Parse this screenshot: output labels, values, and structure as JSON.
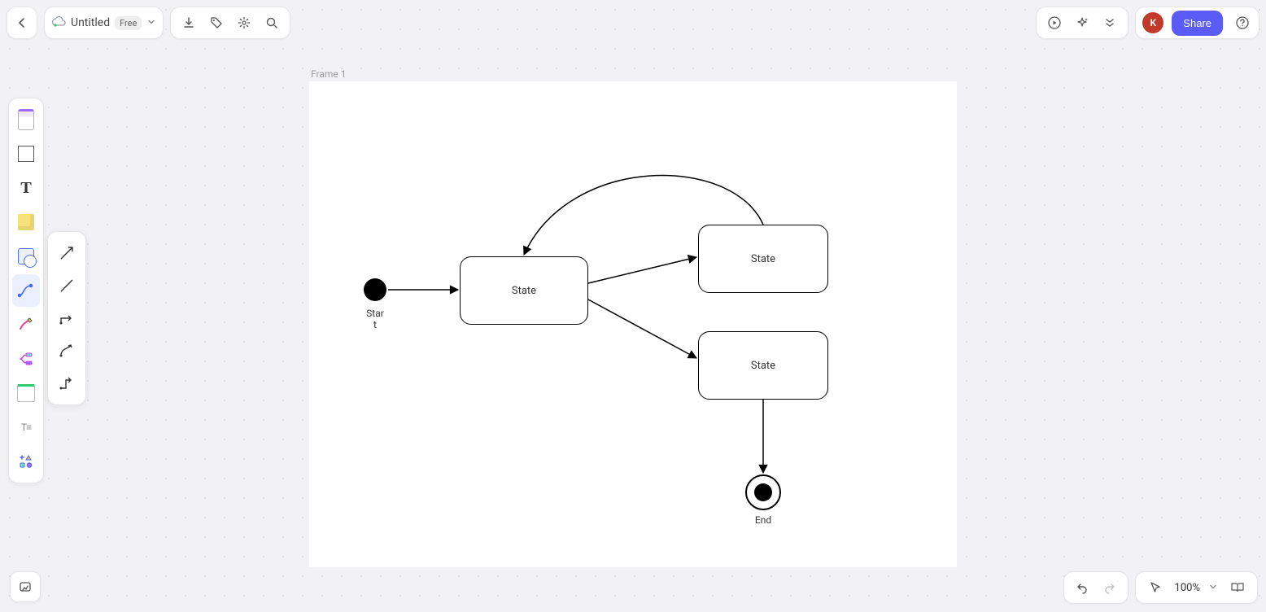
{
  "header": {
    "doc_title": "Untitled",
    "plan_badge": "Free",
    "share_label": "Share",
    "avatar_initial": "K"
  },
  "canvas": {
    "frame_label": "Frame 1"
  },
  "diagram": {
    "start_label": "Star\nt",
    "state1_label": "State",
    "state2_label": "State",
    "state3_label": "State",
    "end_label": "End"
  },
  "footer": {
    "zoom": "100%"
  }
}
